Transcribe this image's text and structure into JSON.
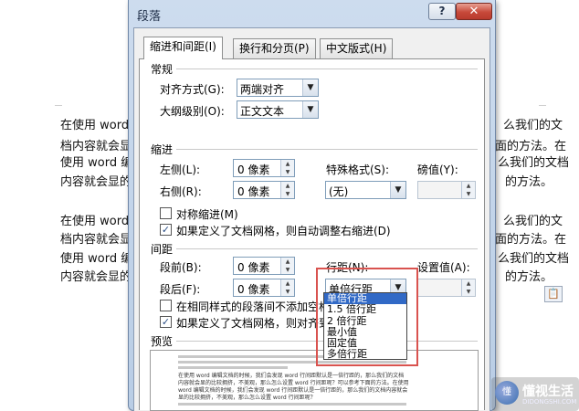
{
  "document": {
    "lines": [
      "在使用 word",
      "档内容就会显",
      "使用 word 编",
      "内容就会显的",
      "在使用 word",
      "档内容就会显",
      "使用 word 编",
      "内容就会显的"
    ],
    "right_lines": [
      "么我们的文",
      "面的方法。在",
      "么我们的文档",
      "的方法。",
      "么我们的文",
      "面的方法。在",
      "么我们的文档",
      "的方法。"
    ]
  },
  "dialog": {
    "title": "段落",
    "help_label": "?",
    "close_label": "✕",
    "tabs": [
      {
        "label": "缩进和间距(I)",
        "active": true
      },
      {
        "label": "换行和分页(P)",
        "active": false
      },
      {
        "label": "中文版式(H)",
        "active": false
      }
    ],
    "general": {
      "heading": "常规",
      "alignment_label": "对齐方式(G):",
      "alignment_value": "两端对齐",
      "outline_label": "大纲级别(O):",
      "outline_value": "正文文本"
    },
    "indent": {
      "heading": "缩进",
      "left_label": "左侧(L):",
      "left_value": "0 像素",
      "right_label": "右侧(R):",
      "right_value": "0 像素",
      "special_label": "特殊格式(S):",
      "special_value": "(无)",
      "by_label": "磅值(Y):",
      "by_value": "",
      "mirror_label": "对称缩进(M)",
      "mirror_checked": false,
      "grid_label": "如果定义了文档网格，则自动调整右缩进(D)",
      "grid_checked": true
    },
    "spacing": {
      "heading": "间距",
      "before_label": "段前(B):",
      "before_value": "0 像素",
      "after_label": "段后(F):",
      "after_value": "0 像素",
      "line_label": "行距(N):",
      "line_value": "单倍行距",
      "at_label": "设置值(A):",
      "at_value": "",
      "nosame_label": "在相同样式的段落间不添加空格",
      "nosame_checked": false,
      "snap_label": "如果定义了文档网格，则对齐到",
      "snap_checked": true
    },
    "line_spacing_options": [
      "单倍行距",
      "1.5 倍行距",
      "2 倍行距",
      "最小值",
      "固定值",
      "多倍行距"
    ],
    "preview": {
      "heading": "预览",
      "text_lines": [
        "在使用 word 编辑文档的时候，我们会发现 word 行间距默认是一倍行距的，那么我们的文档",
        "内容就会显的比较拥挤，不美观，那么怎么设置 word 行间距呢？可以参考下面的方法。在使用",
        "word 编辑文档的时候，我们会发现 word 行间距默认是一倍行距的，那么我们的文档内容就会",
        "显的比较拥挤，不美观，那么怎么设置 word 行间距呢？"
      ]
    }
  },
  "watermark": {
    "name": "懂视生活",
    "sub": "DIDONGSHI.COM",
    "logo": "懂"
  },
  "colors": {
    "highlight": "#3169c6",
    "annotation_box": "#d9534f",
    "close_button": "#c7493a"
  }
}
